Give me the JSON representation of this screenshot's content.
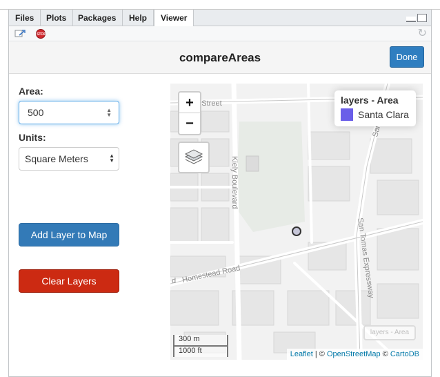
{
  "tabs": [
    "Files",
    "Plots",
    "Packages",
    "Help",
    "Viewer"
  ],
  "active_tab": "Viewer",
  "toolbar": {
    "stop_label": "STOP"
  },
  "gadget": {
    "title": "compareAreas",
    "done_label": "Done"
  },
  "inputs": {
    "area_label": "Area:",
    "area_value": "500",
    "units_label": "Units:",
    "units_selected": "Square Meters"
  },
  "buttons": {
    "add_layer": "Add Layer to Map",
    "clear_layers": "Clear Layers"
  },
  "map": {
    "zoom_in": "+",
    "zoom_out": "−",
    "legend_title": "layers - Area",
    "legend_item": "Santa Clara",
    "legend_color": "#6a5ee9",
    "ghost_legend": "layers - Area",
    "scale_metric": "300 m",
    "scale_imperial": "1000 ft",
    "street_labels": [
      "on Street",
      "Kiely Boulevard",
      "San Tomas Expressway",
      "Homestead Road",
      "San To",
      "d"
    ],
    "attribution": {
      "leaflet": "Leaflet",
      "sep": " | © ",
      "osm": "OpenStreetMap",
      "sep2": " © ",
      "carto": "CartoDB"
    }
  },
  "colors": {
    "primary": "#337ab7",
    "danger": "#cc2a12",
    "done": "#2f7ec0"
  }
}
